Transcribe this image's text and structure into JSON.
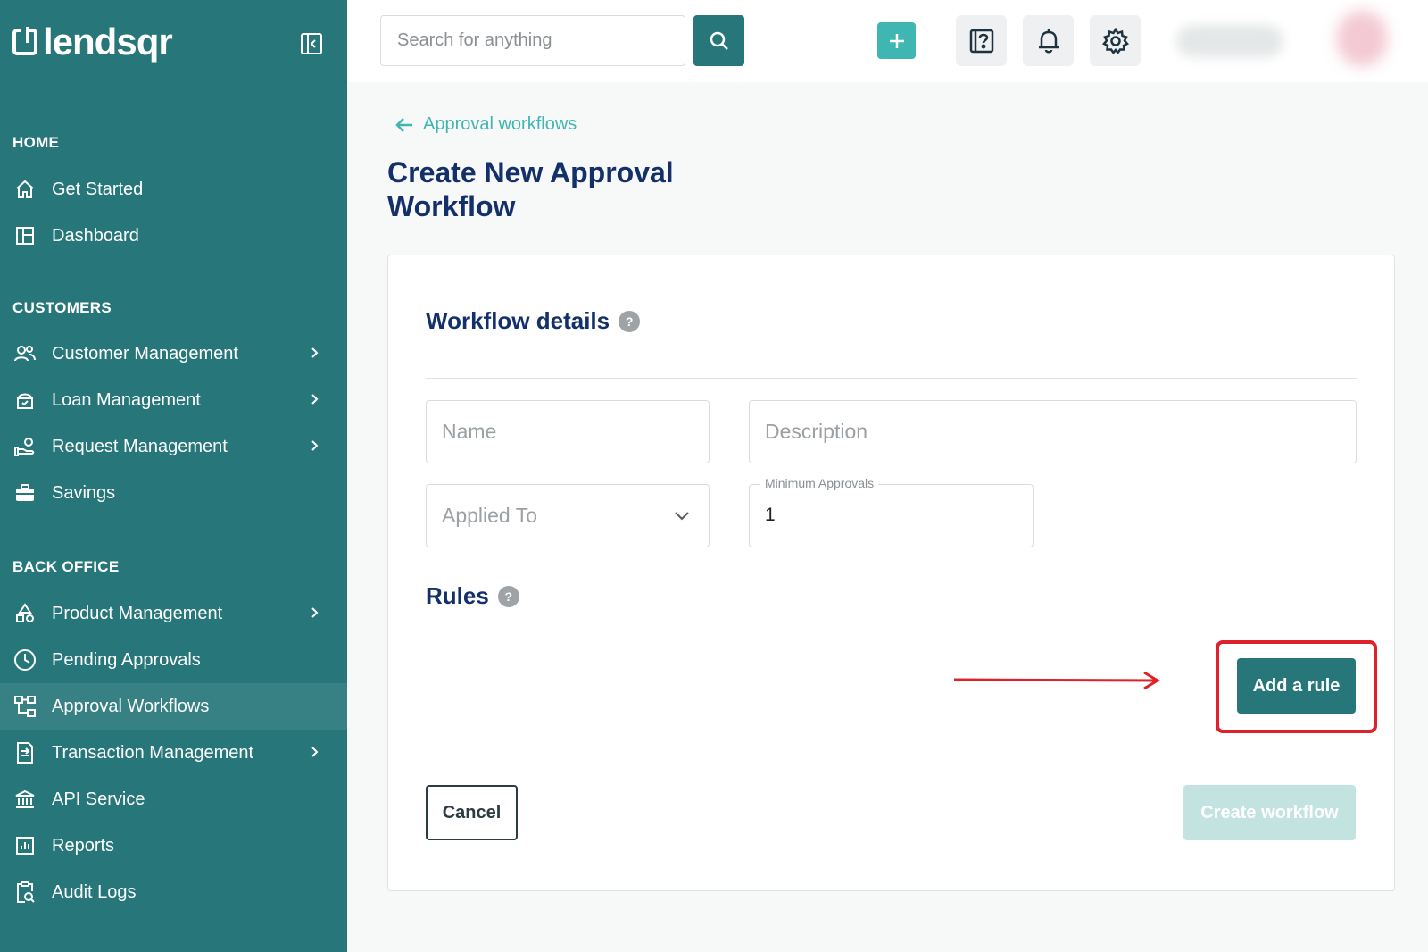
{
  "brand": {
    "name": "lendsqr"
  },
  "sidebar": {
    "sections": {
      "home": "HOME",
      "customers": "CUSTOMERS",
      "back_office": "BACK OFFICE"
    },
    "items": [
      {
        "label": "Get Started",
        "icon": "home-icon"
      },
      {
        "label": "Dashboard",
        "icon": "dashboard-icon"
      },
      {
        "label": "Customer Management",
        "icon": "users-icon",
        "has_submenu": true
      },
      {
        "label": "Loan Management",
        "icon": "loan-icon",
        "has_submenu": true
      },
      {
        "label": "Request Management",
        "icon": "hand-coin-icon",
        "has_submenu": true
      },
      {
        "label": "Savings",
        "icon": "briefcase-icon"
      },
      {
        "label": "Product Management",
        "icon": "shapes-icon",
        "has_submenu": true
      },
      {
        "label": "Pending Approvals",
        "icon": "clock-icon"
      },
      {
        "label": "Approval Workflows",
        "icon": "workflow-icon",
        "active": true
      },
      {
        "label": "Transaction Management",
        "icon": "transaction-icon",
        "has_submenu": true
      },
      {
        "label": "API Service",
        "icon": "bank-icon"
      },
      {
        "label": "Reports",
        "icon": "chart-icon"
      },
      {
        "label": "Audit Logs",
        "icon": "clipboard-search-icon"
      }
    ]
  },
  "topbar": {
    "search_placeholder": "Search for anything"
  },
  "breadcrumb": {
    "back_label": "Approval workflows"
  },
  "page": {
    "title": "Create New Approval Workflow"
  },
  "form": {
    "details_heading": "Workflow details",
    "name_placeholder": "Name",
    "description_placeholder": "Description",
    "applied_to_placeholder": "Applied To",
    "min_approvals_label": "Minimum Approvals",
    "min_approvals_value": "1",
    "rules_heading": "Rules",
    "add_rule_label": "Add a rule",
    "cancel_label": "Cancel",
    "create_label": "Create workflow"
  },
  "colors": {
    "sidebar_bg": "#26767a",
    "accent": "#3fb6b2",
    "title": "#14306a",
    "annotation": "#e0202a",
    "disabled_button": "#c3e3e1"
  }
}
